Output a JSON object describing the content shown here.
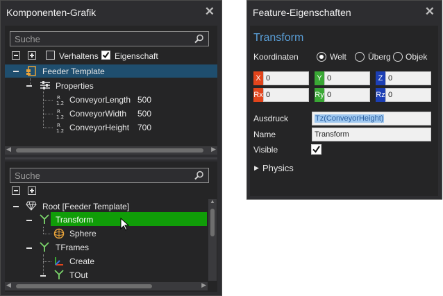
{
  "left_panel": {
    "title": "Komponenten-Grafik",
    "search_top": {
      "placeholder": "Suche"
    },
    "filters": {
      "behaviors_label": "Verhaltens",
      "behaviors_checked": false,
      "properties_label": "Eigenschaft",
      "properties_checked": true
    },
    "tree_top": [
      {
        "label": "Feeder Template",
        "icon": "component-icon",
        "selected": true
      },
      {
        "label": "Properties",
        "icon": "properties-icon"
      },
      {
        "label": "ConveyorLength",
        "value": "500",
        "icon": "real-property-icon"
      },
      {
        "label": "ConveyorWidth",
        "value": "500",
        "icon": "real-property-icon"
      },
      {
        "label": "ConveyorHeight",
        "value": "700",
        "icon": "real-property-icon"
      }
    ],
    "search_bottom": {
      "placeholder": "Suche"
    },
    "tree_bottom": [
      {
        "label": "Root [Feeder Template]",
        "icon": "gem-icon"
      },
      {
        "label": "Transform",
        "icon": "transform-icon",
        "selected": true
      },
      {
        "label": "Sphere",
        "icon": "sphere-icon"
      },
      {
        "label": "TFrames",
        "icon": "transform-icon"
      },
      {
        "label": "Create",
        "icon": "frame-axes-icon"
      },
      {
        "label": "TOut",
        "icon": "transform-icon"
      }
    ]
  },
  "right_panel": {
    "title": "Feature-Eigenschaften",
    "heading": "Transform",
    "coords": {
      "label": "Koordinaten",
      "options": [
        "Welt",
        "Überg",
        "Objek"
      ],
      "selected": "Welt"
    },
    "fields": [
      {
        "axis": "X",
        "value": "0",
        "color": "#e2451c"
      },
      {
        "axis": "Y",
        "value": "0",
        "color": "#3aa835"
      },
      {
        "axis": "Z",
        "value": "0",
        "color": "#1c3fb5"
      },
      {
        "axis": "Rx",
        "value": "0",
        "color": "#e2451c"
      },
      {
        "axis": "Ry",
        "value": "0",
        "color": "#3aa835"
      },
      {
        "axis": "Rz",
        "value": "0",
        "color": "#1c3fb5"
      }
    ],
    "expression": {
      "label": "Ausdruck",
      "value": "Tz(ConveyorHeight)"
    },
    "name": {
      "label": "Name",
      "value": "Transform"
    },
    "visible": {
      "label": "Visible",
      "checked": true
    },
    "physics": {
      "label": "Physics"
    }
  },
  "colors": {
    "panel_bg": "#2d2d30",
    "selection_blue": "#1f4e6e",
    "selection_green": "#109d08",
    "heading_blue": "#5a9fd8"
  }
}
